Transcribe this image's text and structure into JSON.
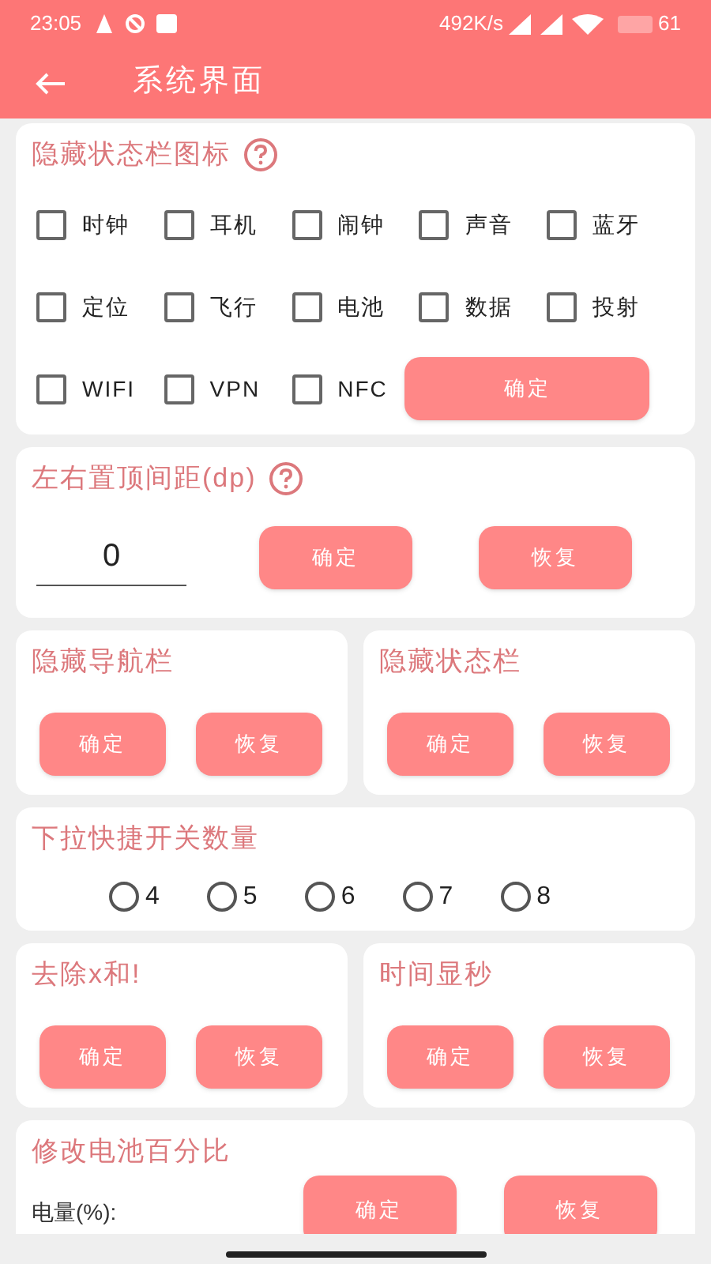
{
  "status_bar": {
    "time": "23:05",
    "speed": "492K/s",
    "battery": "61"
  },
  "app_bar": {
    "title": "系统界面"
  },
  "rows": [
    [
      {
        "kind": "checkbox_grid",
        "title": "隐藏状态栏图标",
        "help": true,
        "items": [
          {
            "label": "时钟",
            "checked": false
          },
          {
            "label": "耳机",
            "checked": false
          },
          {
            "label": "闹钟",
            "checked": false
          },
          {
            "label": "声音",
            "checked": false
          },
          {
            "label": "蓝牙",
            "checked": false
          },
          {
            "label": "定位",
            "checked": false
          },
          {
            "label": "飞行",
            "checked": false
          },
          {
            "label": "电池",
            "checked": false
          },
          {
            "label": "数据",
            "checked": false
          },
          {
            "label": "投射",
            "checked": false
          },
          {
            "label": "WIFI",
            "checked": false
          },
          {
            "label": "VPN",
            "checked": false
          },
          {
            "label": "NFC",
            "checked": false
          }
        ],
        "buttons": [
          "确定"
        ]
      }
    ],
    [
      {
        "kind": "number_input",
        "title": "左右置顶间距(dp)",
        "help": true,
        "value": "0",
        "buttons": [
          "确定",
          "恢复"
        ]
      }
    ],
    [
      {
        "kind": "buttons",
        "title": "隐藏导航栏",
        "buttons": [
          "确定",
          "恢复"
        ]
      },
      {
        "kind": "buttons",
        "title": "隐藏状态栏",
        "buttons": [
          "确定",
          "恢复"
        ]
      }
    ],
    [
      {
        "kind": "radio_group",
        "title": "下拉快捷开关数量",
        "options": [
          {
            "label": "4",
            "selected": false
          },
          {
            "label": "5",
            "selected": false
          },
          {
            "label": "6",
            "selected": false
          },
          {
            "label": "7",
            "selected": false
          },
          {
            "label": "8",
            "selected": false
          }
        ]
      }
    ],
    [
      {
        "kind": "buttons",
        "title": "去除x和!",
        "buttons": [
          "确定",
          "恢复"
        ]
      },
      {
        "kind": "buttons",
        "title": "时间显秒",
        "buttons": [
          "确定",
          "恢复"
        ]
      }
    ],
    [
      {
        "kind": "battery",
        "title": "修改电池百分比",
        "label": "电量(%):",
        "buttons": [
          "确定",
          "恢复"
        ]
      }
    ]
  ]
}
